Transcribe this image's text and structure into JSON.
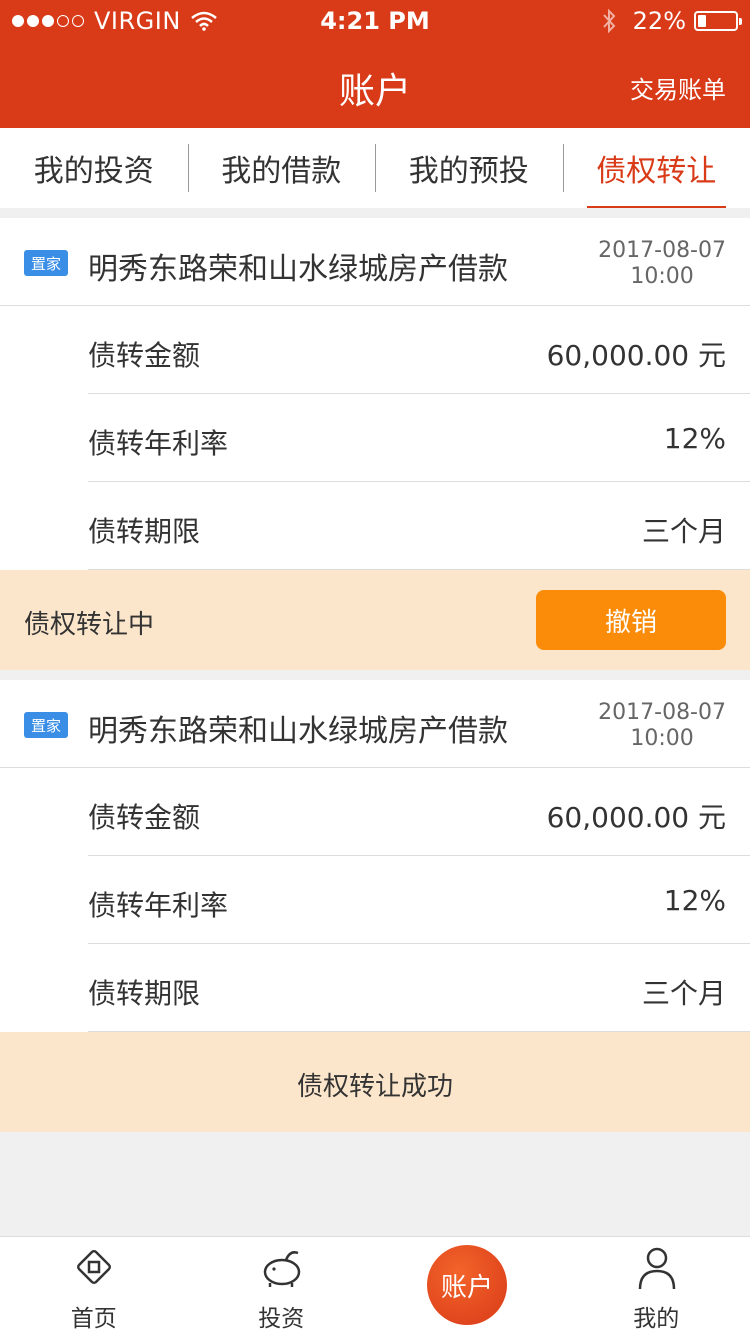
{
  "status_bar": {
    "signal_dots": [
      true,
      true,
      true,
      false,
      false
    ],
    "carrier": "VIRGIN",
    "time": "4:21 PM",
    "battery_text": "22%",
    "battery_level": 0.22
  },
  "nav": {
    "title": "账户",
    "right_link": "交易账单"
  },
  "tabs": [
    {
      "label": "我的投资",
      "active": false
    },
    {
      "label": "我的借款",
      "active": false
    },
    {
      "label": "我的预投",
      "active": false
    },
    {
      "label": "债权转让",
      "active": true
    }
  ],
  "cards": [
    {
      "badge": "置家",
      "title": "明秀东路荣和山水绿城房产借款",
      "date": "2017-08-07",
      "time": "10:00",
      "rows": [
        {
          "label": "债转金额",
          "value": "60,000.00 元"
        },
        {
          "label": "债转年利率",
          "value": "12%"
        },
        {
          "label": "债转期限",
          "value": "三个月"
        }
      ],
      "status": "债权转让中",
      "action": "撤销"
    },
    {
      "badge": "置家",
      "title": "明秀东路荣和山水绿城房产借款",
      "date": "2017-08-07",
      "time": "10:00",
      "rows": [
        {
          "label": "债转金额",
          "value": "60,000.00 元"
        },
        {
          "label": "债转年利率",
          "value": "12%"
        },
        {
          "label": "债转期限",
          "value": "三个月"
        }
      ],
      "status": "债权转让成功"
    }
  ],
  "tabbar": {
    "home": {
      "label": "首页",
      "icon": "home-icon"
    },
    "invest": {
      "label": "投资",
      "icon": "piggy-bank-icon"
    },
    "account": {
      "label": "账户"
    },
    "mine": {
      "label": "我的",
      "icon": "user-icon"
    }
  },
  "colors": {
    "primary": "#d93a18",
    "badge": "#3a8ee6",
    "action": "#fb8c0a",
    "footer_bg": "#fce6cb"
  }
}
